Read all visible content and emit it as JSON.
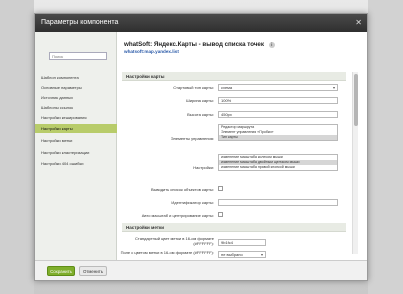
{
  "dialog": {
    "title": "Параметры компонента",
    "close_glyph": "✕"
  },
  "sidebar": {
    "search_placeholder": "Поиск",
    "items": [
      {
        "label": "Шаблон компонента"
      },
      {
        "label": "Основные параметры"
      },
      {
        "label": "Источник данных"
      },
      {
        "label": "Шаблоны ссылок"
      },
      {
        "label": "Настройки кеширования"
      },
      {
        "label": "Настройки карты"
      },
      {
        "label": "Настройки метки"
      },
      {
        "label": "Настройки кластеризации"
      },
      {
        "label": "Настройки 404 ошибки"
      }
    ],
    "active_index": 5
  },
  "main": {
    "component_title": "whatSoft: Яндекс.Карты - вывод списка точек",
    "info_glyph": "i",
    "component_subtitle": "whatsoft:map.yandex.list",
    "section_map": "Настройки карты",
    "rows": {
      "map_type_label": "Стартовый тип карты:",
      "map_type_value": "схема",
      "width_label": "Ширина карты:",
      "width_value": "100%",
      "height_label": "Высота карты:",
      "height_value": "450px",
      "controls_label": "Элементы управления:",
      "controls_options": [
        "Редактор маршрута",
        "Элемент управления «Пробки»",
        "Тип карты"
      ],
      "settings_label": "Настройки:",
      "settings_options": [
        "изменение масштаба колесом мыши",
        "изменение масштаба двойным щелчком мыши",
        "изменение масштаба правой кнопкой мыши"
      ],
      "show_list_label": "Выводить список объектов карты:",
      "map_id_label": "Идентификатор карты:",
      "auto_scale_label": "Авто масштаб и центрирование карты:"
    },
    "section_mark": "Настройки метки",
    "mark_rows": {
      "color_label": "Стандартный цвет метки в 16-ом формате (#FFFFFF):",
      "color_value": "9b1fc4",
      "field_label": "Поле с цветом метки в 16-ом формате (#FFFFFF):",
      "field_value": "не выбрано"
    },
    "select_arrow": "▾"
  },
  "footer": {
    "save_label": "Сохранить",
    "cancel_label": "Отменить"
  }
}
